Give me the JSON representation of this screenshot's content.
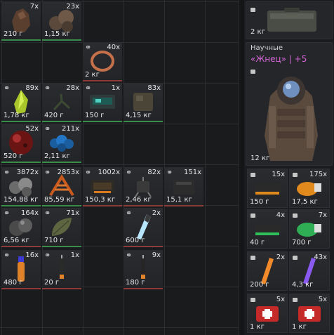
{
  "inventory": {
    "items": [
      {
        "id": "i1",
        "count": "7x",
        "weight": "210 г",
        "icon": "chunk-icon"
      },
      {
        "id": "i2",
        "count": "23x",
        "weight": "1,15 кг",
        "icon": "ore-icon"
      },
      {
        "id": "i3",
        "count": "40x",
        "weight": "2 кг",
        "icon": "ring-icon"
      },
      {
        "id": "i4",
        "count": "89x",
        "weight": "1,78 кг",
        "icon": "crystal-icon"
      },
      {
        "id": "i5",
        "count": "28x",
        "weight": "420 г",
        "icon": "branch-icon"
      },
      {
        "id": "i6",
        "count": "1x",
        "weight": "150 г",
        "icon": "device-icon"
      },
      {
        "id": "i7",
        "count": "83x",
        "weight": "4,15 кг",
        "icon": "block-icon"
      },
      {
        "id": "i8",
        "count": "52x",
        "weight": "520 г",
        "icon": "red-sphere-icon"
      },
      {
        "id": "i9",
        "count": "211x",
        "weight": "2,11 кг",
        "icon": "blue-moss-icon"
      },
      {
        "id": "i10",
        "count": "3872x",
        "weight": "154,88 кг",
        "icon": "stones-icon"
      },
      {
        "id": "i11",
        "count": "2853x",
        "weight": "85,59 кг",
        "icon": "fern-icon"
      },
      {
        "id": "i12",
        "count": "1002x",
        "weight": "150,3 кг",
        "icon": "chip-icon"
      },
      {
        "id": "i13",
        "count": "82x",
        "weight": "2,46 кг",
        "icon": "trap-icon"
      },
      {
        "id": "i14",
        "count": "151x",
        "weight": "15,1 кг",
        "icon": "box-icon"
      },
      {
        "id": "i15",
        "count": "164x",
        "weight": "6,56 кг",
        "icon": "ball-icon"
      },
      {
        "id": "i16",
        "count": "71x",
        "weight": "710 г",
        "icon": "leaf-icon"
      },
      {
        "id": "i17",
        "count": "2x",
        "weight": "600 г",
        "icon": "blue-vial-icon"
      },
      {
        "id": "i18",
        "count": "16x",
        "weight": "480 г",
        "icon": "orange-vial-icon"
      },
      {
        "id": "i19",
        "count": "1x",
        "weight": "20 г",
        "icon": "syringe-icon"
      },
      {
        "id": "i20",
        "count": "9x",
        "weight": "180 г",
        "icon": "injector-icon"
      }
    ]
  },
  "equipment": {
    "case": {
      "weight": "2 кг",
      "icon": "case-icon"
    },
    "armor": {
      "category": "Научные",
      "name": "«Жнец» | +5",
      "weight": "12 кг",
      "icon": "suit-icon"
    },
    "cells": [
      {
        "count": "15x",
        "weight": "150 г",
        "icon": "orange-device-icon"
      },
      {
        "count": "175x",
        "weight": "17,5 кг",
        "icon": "orange-canister-icon"
      },
      {
        "count": "4x",
        "weight": "40 г",
        "icon": "green-device-icon"
      },
      {
        "count": "7x",
        "weight": "700 г",
        "icon": "green-canister-icon"
      },
      {
        "count": "2x",
        "weight": "200 г",
        "icon": "orange-stick-icon"
      },
      {
        "count": "43x",
        "weight": "4,3 кг",
        "icon": "purple-stick-icon"
      },
      {
        "count": "5x",
        "weight": "1 кг",
        "icon": "red-kit-icon"
      },
      {
        "count": "5x",
        "weight": "1 кг",
        "icon": "red-kit-icon"
      }
    ]
  },
  "colors": {
    "accent_pink": "#d665d6",
    "red_line": "#8c3a3a",
    "green_line": "#3a8c4a"
  }
}
